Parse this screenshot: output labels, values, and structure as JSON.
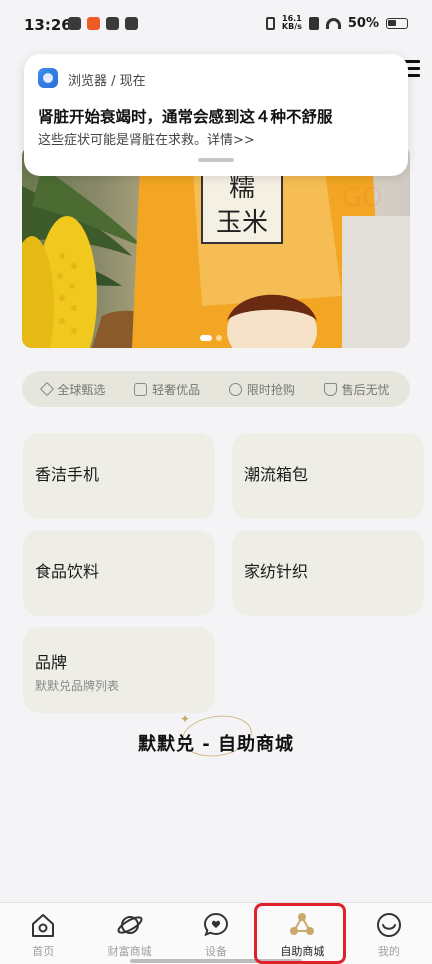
{
  "status_bar": {
    "time": "13:26",
    "net_speed_value": "16.1",
    "net_speed_unit": "KB/s",
    "battery": "50%"
  },
  "notification": {
    "source": "浏览器 / 现在",
    "title": "肾脏开始衰竭时，通常会感到这４种不舒服",
    "body": "这些症状可能是肾脏在求救。详情>>"
  },
  "features": [
    {
      "label": "全球甄选",
      "icon": "diamond-icon"
    },
    {
      "label": "轻奢优品",
      "icon": "bag-icon"
    },
    {
      "label": "限时抢购",
      "icon": "clock-icon"
    },
    {
      "label": "售后无忧",
      "icon": "shield-icon"
    }
  ],
  "categories": [
    {
      "title": "香洁手机"
    },
    {
      "title": "潮流箱包"
    },
    {
      "title": "食品饮料"
    },
    {
      "title": "家纺针织"
    },
    {
      "title": "品牌",
      "subtitle": "默默兑品牌列表"
    }
  ],
  "brand_footer": "默默兑 - 自助商城",
  "nav": [
    {
      "label": "首页",
      "icon": "home-icon"
    },
    {
      "label": "财富商城",
      "icon": "planet-icon"
    },
    {
      "label": "设备",
      "icon": "heart-chat-icon"
    },
    {
      "label": "自助商城",
      "icon": "mall-icon",
      "active": true
    },
    {
      "label": "我的",
      "icon": "smile-icon"
    }
  ],
  "colors": {
    "background": "#f4f4f6",
    "card": "#efeee6",
    "feature_strip": "#e7e6dc",
    "active_nav": "#c9a86a",
    "highlight_box": "#e0202a"
  }
}
